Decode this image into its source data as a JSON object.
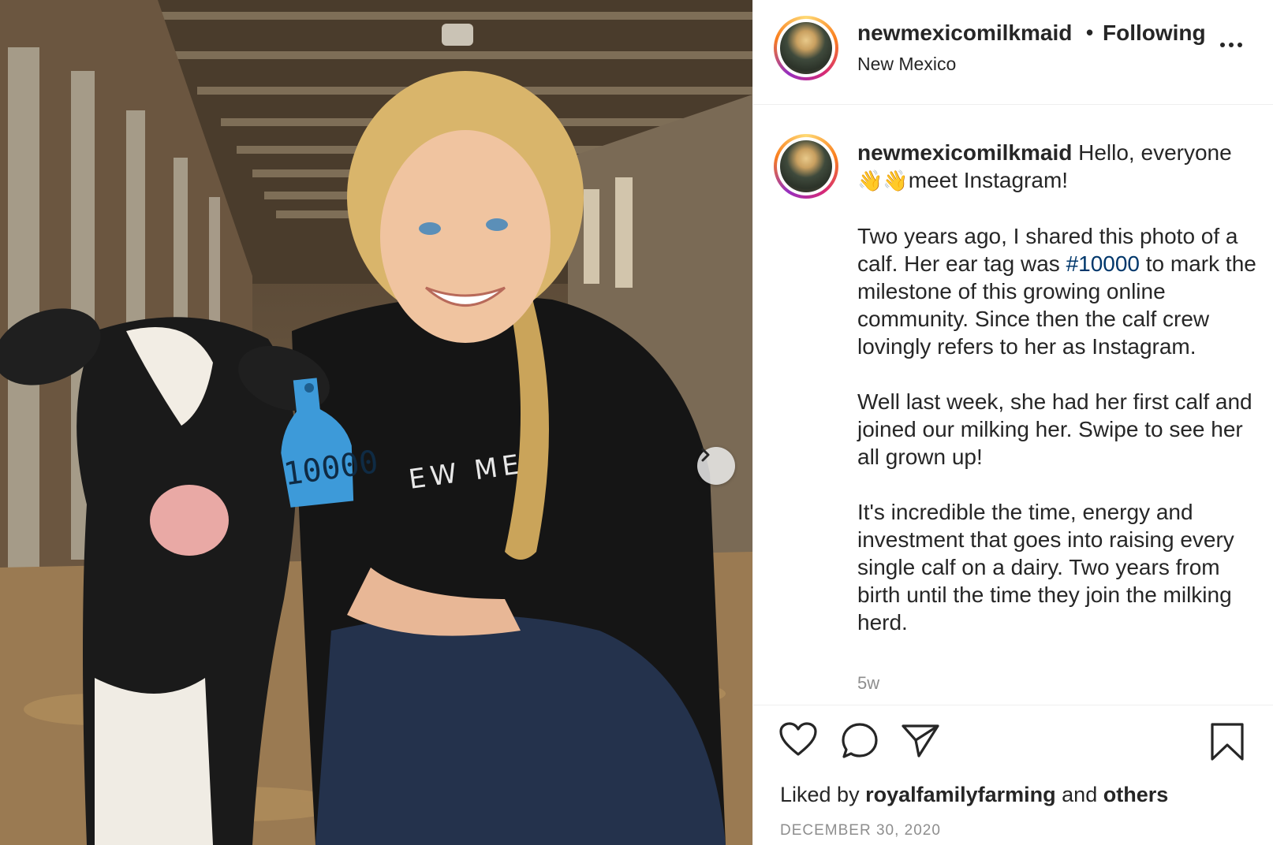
{
  "post": {
    "username": "newmexicomilkmaid",
    "follow_status": "Following",
    "separator": "•",
    "location": "New Mexico",
    "caption_user": "newmexicomilkmaid",
    "caption_line1": "Hello, everyone",
    "caption_emoji": "👋👋",
    "caption_line1b": "meet Instagram!",
    "para1_a": "Two years ago, I shared this photo of a calf. Her ear tag was ",
    "para1_hashtag": "#10000",
    "para1_b": " to mark the milestone of this growing online community. Since then the calf crew lovingly refers to her as Instagram.",
    "para2": "Well last week, she had her first calf and joined our milking her. Swipe to see her all grown up!",
    "para3": "It's incredible the time, energy and investment that goes into raising every single calf on a dairy. Two years from birth until the time they join the milking herd.",
    "time_ago": "5w",
    "liked_prefix": "Liked by ",
    "liked_user": "royalfamilyfarming",
    "liked_and": " and ",
    "liked_others": "others",
    "date": "DECEMBER 30, 2020"
  },
  "photo": {
    "ear_tag_number": "10000",
    "shirt_text": "EW ME"
  },
  "icons": [
    "heart-icon",
    "comment-icon",
    "share-icon",
    "bookmark-icon",
    "more-icon",
    "chevron-right-icon"
  ],
  "colors": {
    "text": "#262626",
    "muted": "#8e8e8e",
    "hashtag": "#00376b",
    "ear_tag": "#3d9ad9"
  }
}
